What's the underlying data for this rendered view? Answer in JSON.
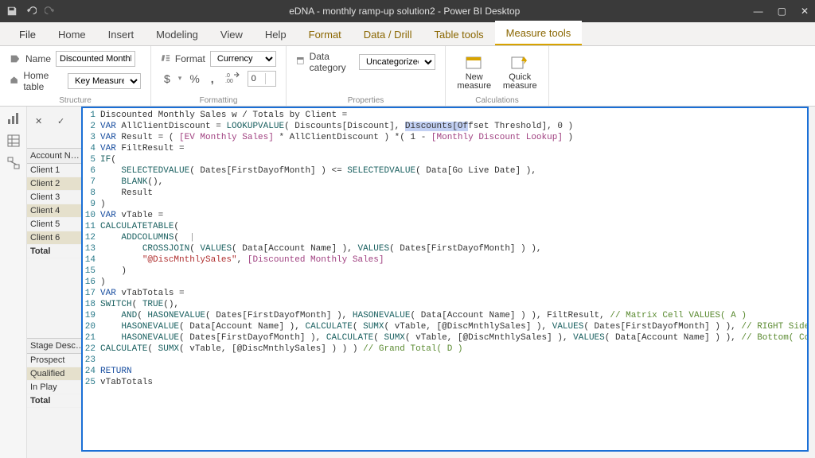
{
  "titlebar": {
    "title": "eDNA - monthly ramp-up solution2 - Power BI Desktop"
  },
  "tabs": {
    "file": "File",
    "home": "Home",
    "insert": "Insert",
    "modeling": "Modeling",
    "view": "View",
    "help": "Help",
    "format": "Format",
    "datadrill": "Data / Drill",
    "tabletools": "Table tools",
    "measuretools": "Measure tools"
  },
  "structure": {
    "group_label": "Structure",
    "name_label": "Name",
    "name_value": "Discounted Monthl…",
    "home_table_label": "Home table",
    "home_table_value": "Key Measures"
  },
  "formatting": {
    "group_label": "Formatting",
    "format_label": "Format",
    "format_value": "Currency",
    "dollar": "$",
    "percent": "%",
    "comma": ",",
    "decbtn": ".00→.0",
    "decimals": "0"
  },
  "properties": {
    "group_label": "Properties",
    "data_category_label": "Data category",
    "data_category_value": "Uncategorized"
  },
  "calculations": {
    "group_label": "Calculations",
    "new_measure": "New measure",
    "quick_measure": "Quick measure"
  },
  "bar_buttons": {
    "cancel": "✕",
    "commit": "✓"
  },
  "left_panel": {
    "account_header": "Account N…",
    "clients": [
      "Client 1",
      "Client 2",
      "Client 3",
      "Client 4",
      "Client 5",
      "Client 6"
    ],
    "total": "Total",
    "stage_header": "Stage Desc…",
    "stages": [
      "Prospect",
      "Qualified",
      "In Play"
    ],
    "stage_total": "Total"
  },
  "code": {
    "l1_plain": "Discounted Monthly Sales w / Totals by Client =",
    "l2_var": "VAR",
    "l2_name": " AllClientDiscount ",
    "l2_eq": "= ",
    "l2_fn": "LOOKUPVALUE",
    "l2_open": "( ",
    "l2_a1": "Discounts[Discount], ",
    "l2_a2a": "Discounts[Of",
    "l2_a2b": "fset Threshold], ",
    "l2_a3": "0 ",
    "l2_close": ")",
    "l3_var": "VAR",
    "l3_name": " Result ",
    "l3_eq": "= ( ",
    "l3_m1": "[EV Monthly Sales]",
    "l3_mid": " * AllClientDiscount ) *( 1 - ",
    "l3_m2": "[Monthly Discount Lookup]",
    "l3_end": " )",
    "l4_var": "VAR",
    "l4_name": " FiltResult ",
    "l4_eq": "=",
    "l5_fn": "IF",
    "l5_open": "(",
    "l6_pad": "    ",
    "l6_fn": "SELECTEDVALUE",
    "l6_a": "( Dates[FirstDayofMonth] ) <= ",
    "l6_fn2": "SELECTEDVALUE",
    "l6_b": "( Data[Go Live Date] ),",
    "l7_pad": "    ",
    "l7_fn": "BLANK",
    "l7_a": "(),",
    "l8_pad": "    ",
    "l8_txt": "Result",
    "l9_close": ")",
    "l10_var": "VAR",
    "l10_name": " vTable ",
    "l10_eq": "=",
    "l11_fn": "CALCULATETABLE",
    "l11_open": "(",
    "l12_pad": "    ",
    "l12_fn": "ADDCOLUMNS",
    "l12_open": "(",
    "l12_cursor": "  |",
    "l13_pad": "        ",
    "l13_fn": "CROSSJOIN",
    "l13_a": "( ",
    "l13_fn2": "VALUES",
    "l13_b": "( Data[Account Name] ), ",
    "l13_fn3": "VALUES",
    "l13_c": "( Dates[FirstDayofMonth] ) ),",
    "l14_pad": "        ",
    "l14_str": "\"@DiscMnthlySales\"",
    "l14_mid": ", ",
    "l14_br": "[Discounted Monthly Sales]",
    "l15_pad": "    ",
    "l15_close": ")",
    "l16_close": ")",
    "l17_var": "VAR",
    "l17_name": " vTabTotals ",
    "l17_eq": "=",
    "l18_fn": "SWITCH",
    "l18_a": "( ",
    "l18_fn2": "TRUE",
    "l18_b": "(),",
    "l19_pad": "    ",
    "l19_fn": "AND",
    "l19_a": "( ",
    "l19_fn2": "HASONEVALUE",
    "l19_b": "( Dates[FirstDayofMonth] ), ",
    "l19_fn3": "HASONEVALUE",
    "l19_c": "( Data[Account Name] ) ), FiltResult, ",
    "l19_cm": "// Matrix Cell VALUES( A )",
    "l20_pad": "    ",
    "l20_fn": "HASONEVALUE",
    "l20_a": "( Data[Account Name] ), ",
    "l20_fn2": "CALCULATE",
    "l20_b": "( ",
    "l20_fn3": "SUMX",
    "l20_c": "( vTable, [@DiscMnthlySales] ), ",
    "l20_fn4": "VALUES",
    "l20_d": "( Dates[FirstDayofMonth] ) ), ",
    "l20_cm": "// RIGHT Side( Row ) Totals( B )",
    "l21_pad": "    ",
    "l21_fn": "HASONEVALUE",
    "l21_a": "( Dates[FirstDayofMonth] ), ",
    "l21_fn2": "CALCULATE",
    "l21_b": "( ",
    "l21_fn3": "SUMX",
    "l21_c": "( vTable, [@DiscMnthlySales] ), ",
    "l21_fn4": "VALUES",
    "l21_d": "( Data[Account Name] ) ), ",
    "l21_cm": "// Bottom( Column ) Totals( C )",
    "l22_fn": "CALCULATE",
    "l22_a": "( ",
    "l22_fn2": "SUMX",
    "l22_b": "( vTable, [@DiscMnthlySales] ) ) ) ",
    "l22_cm": "// Grand Total( D )",
    "l23": "",
    "l24_kw": "RETURN",
    "l25_txt": "vTabTotals"
  }
}
